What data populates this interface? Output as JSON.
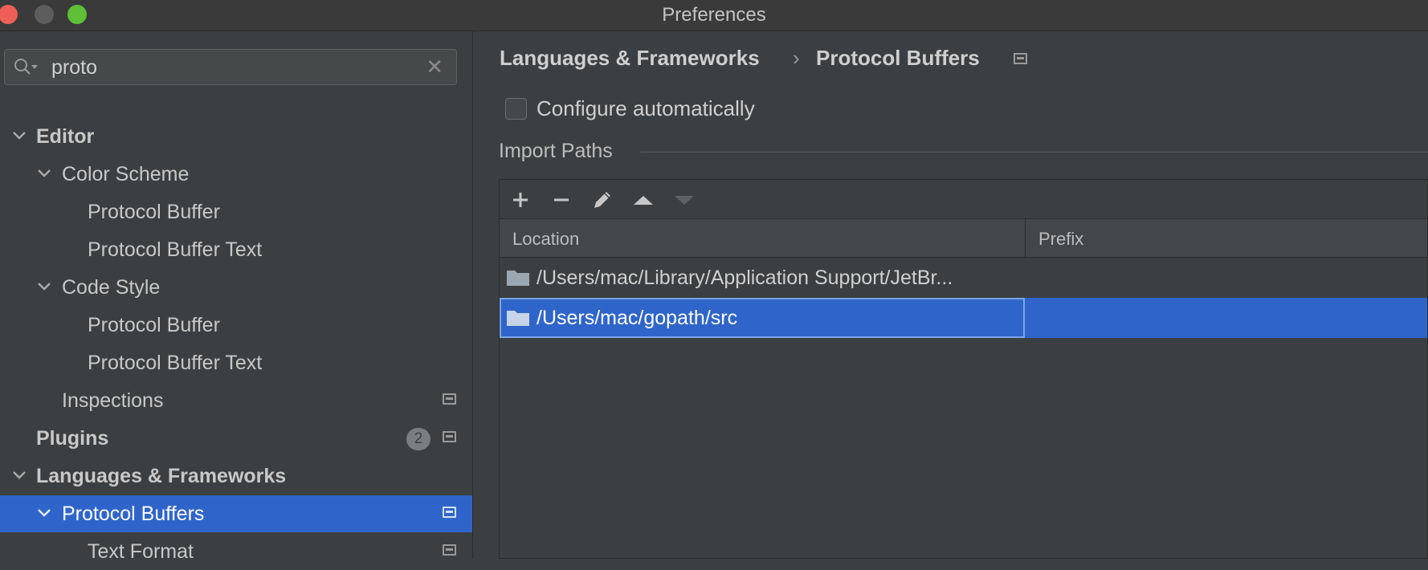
{
  "window": {
    "title": "Preferences"
  },
  "search": {
    "value": "proto"
  },
  "sidebar": {
    "items": [
      {
        "label": "Editor"
      },
      {
        "label": "Color Scheme"
      },
      {
        "label": "Protocol Buffer"
      },
      {
        "label": "Protocol Buffer Text"
      },
      {
        "label": "Code Style"
      },
      {
        "label": "Protocol Buffer"
      },
      {
        "label": "Protocol Buffer Text"
      },
      {
        "label": "Inspections"
      },
      {
        "label": "Plugins",
        "badge": "2"
      },
      {
        "label": "Languages & Frameworks"
      },
      {
        "label": "Protocol Buffers"
      },
      {
        "label": "Text Format"
      }
    ]
  },
  "breadcrumb": {
    "parent": "Languages & Frameworks",
    "separator": "›",
    "current": "Protocol Buffers"
  },
  "options": {
    "configure_label": "Configure automatically",
    "configure_checked": false
  },
  "import_paths": {
    "title": "Import Paths",
    "columns": {
      "location": "Location",
      "prefix": "Prefix"
    },
    "rows": [
      {
        "location": "/Users/mac/Library/Application Support/JetBr...",
        "prefix": ""
      },
      {
        "location": "/Users/mac/gopath/src",
        "prefix": ""
      }
    ],
    "selected_row": 1
  },
  "colors": {
    "selection": "#2f65ca",
    "background": "#3c3f41"
  }
}
